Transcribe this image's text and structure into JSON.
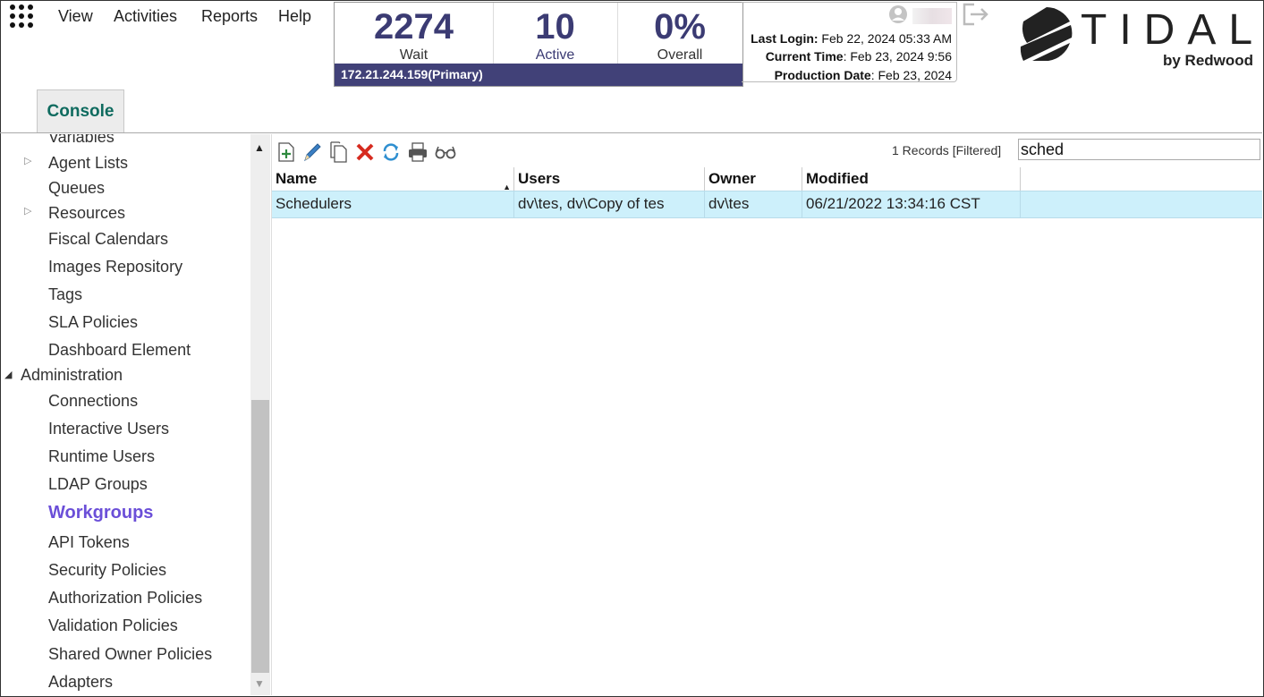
{
  "menu": [
    "View",
    "Activities",
    "Reports",
    "Help"
  ],
  "stats": {
    "wait": {
      "value": "2274",
      "label": "Wait"
    },
    "active": {
      "value": "10",
      "label": "Active"
    },
    "overall": {
      "value": "0%",
      "label": "Overall"
    },
    "server": "172.21.244.159(Primary)"
  },
  "session": {
    "last_login_label": "Last Login:",
    "last_login_value": " Feb 22, 2024 05:33 AM",
    "current_time_label": "Current Time",
    "current_time_value": ": Feb 23, 2024 9:56",
    "production_date_label": "Production Date",
    "production_date_value": ": Feb 23, 2024"
  },
  "logo": {
    "name": "TIDAL",
    "sub": "by Redwood"
  },
  "tab": {
    "console": "Console"
  },
  "sidebar": {
    "items": [
      {
        "label": "Variables"
      },
      {
        "label": "Agent Lists"
      },
      {
        "label": "Queues"
      },
      {
        "label": "Resources"
      },
      {
        "label": "Fiscal Calendars"
      },
      {
        "label": "Images Repository"
      },
      {
        "label": "Tags"
      },
      {
        "label": "SLA Policies"
      },
      {
        "label": "Dashboard Element"
      },
      {
        "label": "Administration"
      },
      {
        "label": "Connections"
      },
      {
        "label": "Interactive Users"
      },
      {
        "label": "Runtime Users"
      },
      {
        "label": "LDAP Groups"
      },
      {
        "label": "Workgroups"
      },
      {
        "label": "API Tokens"
      },
      {
        "label": "Security Policies"
      },
      {
        "label": "Authorization Policies"
      },
      {
        "label": "Validation Policies"
      },
      {
        "label": "Shared Owner Policies"
      },
      {
        "label": "Adapters"
      }
    ]
  },
  "toolbar": {
    "records": "1 Records [Filtered]",
    "filter_value": "sched"
  },
  "grid": {
    "columns": [
      "Name",
      "Users",
      "Owner",
      "Modified"
    ],
    "rows": [
      {
        "name": "Schedulers",
        "users": "dv\\tes, dv\\Copy of tes",
        "owner": "dv\\tes",
        "modified": "06/21/2022 13:34:16 CST"
      }
    ]
  },
  "colors": {
    "accent": "#3b3b73",
    "server_bar": "#414178",
    "selected_nav": "#6b4fd8",
    "console_tab": "#0f6b5f",
    "row_highlight": "#cdf0fb"
  }
}
